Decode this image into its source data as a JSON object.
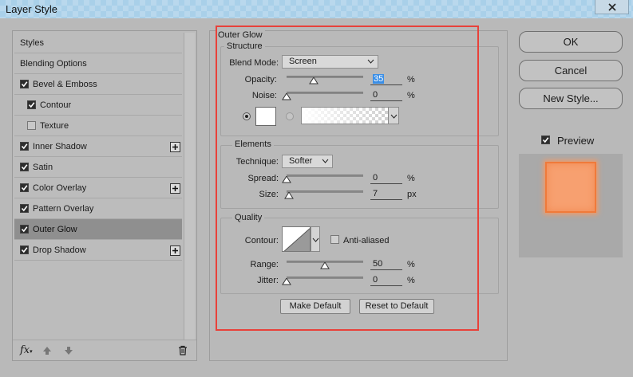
{
  "window": {
    "title": "Layer Style"
  },
  "sidebar": {
    "items": [
      {
        "label": "Styles",
        "checkbox": null,
        "indent": false,
        "plus": false,
        "selected": false
      },
      {
        "label": "Blending Options",
        "checkbox": null,
        "indent": false,
        "plus": false,
        "selected": false
      },
      {
        "label": "Bevel & Emboss",
        "checkbox": true,
        "indent": false,
        "plus": false,
        "selected": false
      },
      {
        "label": "Contour",
        "checkbox": true,
        "indent": true,
        "plus": false,
        "selected": false
      },
      {
        "label": "Texture",
        "checkbox": false,
        "indent": true,
        "plus": false,
        "selected": false
      },
      {
        "label": "Inner Shadow",
        "checkbox": true,
        "indent": false,
        "plus": true,
        "selected": false
      },
      {
        "label": "Satin",
        "checkbox": true,
        "indent": false,
        "plus": false,
        "selected": false
      },
      {
        "label": "Color Overlay",
        "checkbox": true,
        "indent": false,
        "plus": true,
        "selected": false
      },
      {
        "label": "Pattern Overlay",
        "checkbox": true,
        "indent": false,
        "plus": false,
        "selected": false
      },
      {
        "label": "Outer Glow",
        "checkbox": true,
        "indent": false,
        "plus": false,
        "selected": true
      },
      {
        "label": "Drop Shadow",
        "checkbox": true,
        "indent": false,
        "plus": true,
        "selected": false
      }
    ],
    "footer": {
      "fx_label": "fx"
    }
  },
  "outer_glow": {
    "title": "Outer Glow",
    "structure": {
      "title": "Structure",
      "blend_mode_label": "Blend Mode:",
      "blend_mode_value": "Screen",
      "opacity_label": "Opacity:",
      "opacity_value": "35",
      "opacity_level": 35,
      "opacity_unit": "%",
      "noise_label": "Noise:",
      "noise_value": "0",
      "noise_level": 0,
      "noise_unit": "%",
      "color_radio_selected": true,
      "gradient_radio_selected": false,
      "swatch_color": "#ffffff"
    },
    "elements": {
      "title": "Elements",
      "technique_label": "Technique:",
      "technique_value": "Softer",
      "spread_label": "Spread:",
      "spread_value": "0",
      "spread_level": 0,
      "spread_unit": "%",
      "size_label": "Size:",
      "size_value": "7",
      "size_level": 3,
      "size_unit": "px"
    },
    "quality": {
      "title": "Quality",
      "contour_label": "Contour:",
      "anti_aliased_label": "Anti-aliased",
      "anti_aliased": false,
      "range_label": "Range:",
      "range_value": "50",
      "range_level": 50,
      "range_unit": "%",
      "jitter_label": "Jitter:",
      "jitter_value": "0",
      "jitter_level": 0,
      "jitter_unit": "%"
    },
    "make_default_label": "Make Default",
    "reset_default_label": "Reset to Default"
  },
  "right": {
    "ok_label": "OK",
    "cancel_label": "Cancel",
    "new_style_label": "New Style...",
    "preview_label": "Preview",
    "preview_checked": true
  },
  "colors": {
    "highlight": "#e8413a",
    "preview_fill": "#f7a070",
    "selected_row": "#8f8f8f"
  }
}
